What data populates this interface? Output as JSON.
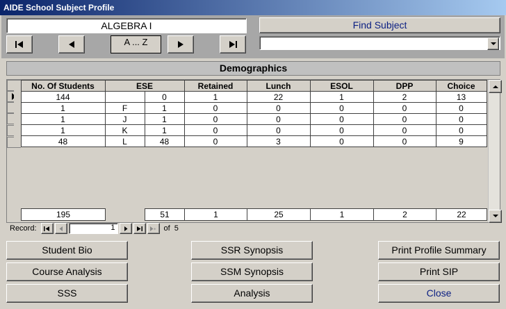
{
  "window": {
    "title": "AIDE School Subject Profile"
  },
  "header": {
    "subject": "ALGEBRA I",
    "find_label": "Find Subject",
    "az_label": "A ... Z",
    "dropdown_value": ""
  },
  "section": {
    "title": "Demographics"
  },
  "table": {
    "columns": [
      "No. Of Students",
      "ESE",
      "Retained",
      "Lunch",
      "ESOL",
      "DPP",
      "Choice"
    ],
    "rows": [
      {
        "students": "144",
        "ese_code": "",
        "ese": "0",
        "retained": "1",
        "lunch": "22",
        "esol": "1",
        "dpp": "2",
        "choice": "13"
      },
      {
        "students": "1",
        "ese_code": "F",
        "ese": "1",
        "retained": "0",
        "lunch": "0",
        "esol": "0",
        "dpp": "0",
        "choice": "0"
      },
      {
        "students": "1",
        "ese_code": "J",
        "ese": "1",
        "retained": "0",
        "lunch": "0",
        "esol": "0",
        "dpp": "0",
        "choice": "0"
      },
      {
        "students": "1",
        "ese_code": "K",
        "ese": "1",
        "retained": "0",
        "lunch": "0",
        "esol": "0",
        "dpp": "0",
        "choice": "0"
      },
      {
        "students": "48",
        "ese_code": "L",
        "ese": "48",
        "retained": "0",
        "lunch": "3",
        "esol": "0",
        "dpp": "0",
        "choice": "9"
      }
    ],
    "totals": {
      "students": "195",
      "ese": "51",
      "retained": "1",
      "lunch": "25",
      "esol": "1",
      "dpp": "2",
      "choice": "22"
    }
  },
  "record_nav": {
    "label": "Record:",
    "current": "1",
    "of_label": "of",
    "total": "5"
  },
  "buttons": {
    "student_bio": "Student Bio",
    "course_analysis": "Course Analysis",
    "sss": "SSS",
    "ssr_synopsis": "SSR Synopsis",
    "ssm_synopsis": "SSM Synopsis",
    "analysis": "Analysis",
    "print_profile_summary": "Print Profile Summary",
    "print_sip": "Print SIP",
    "close": "Close"
  }
}
